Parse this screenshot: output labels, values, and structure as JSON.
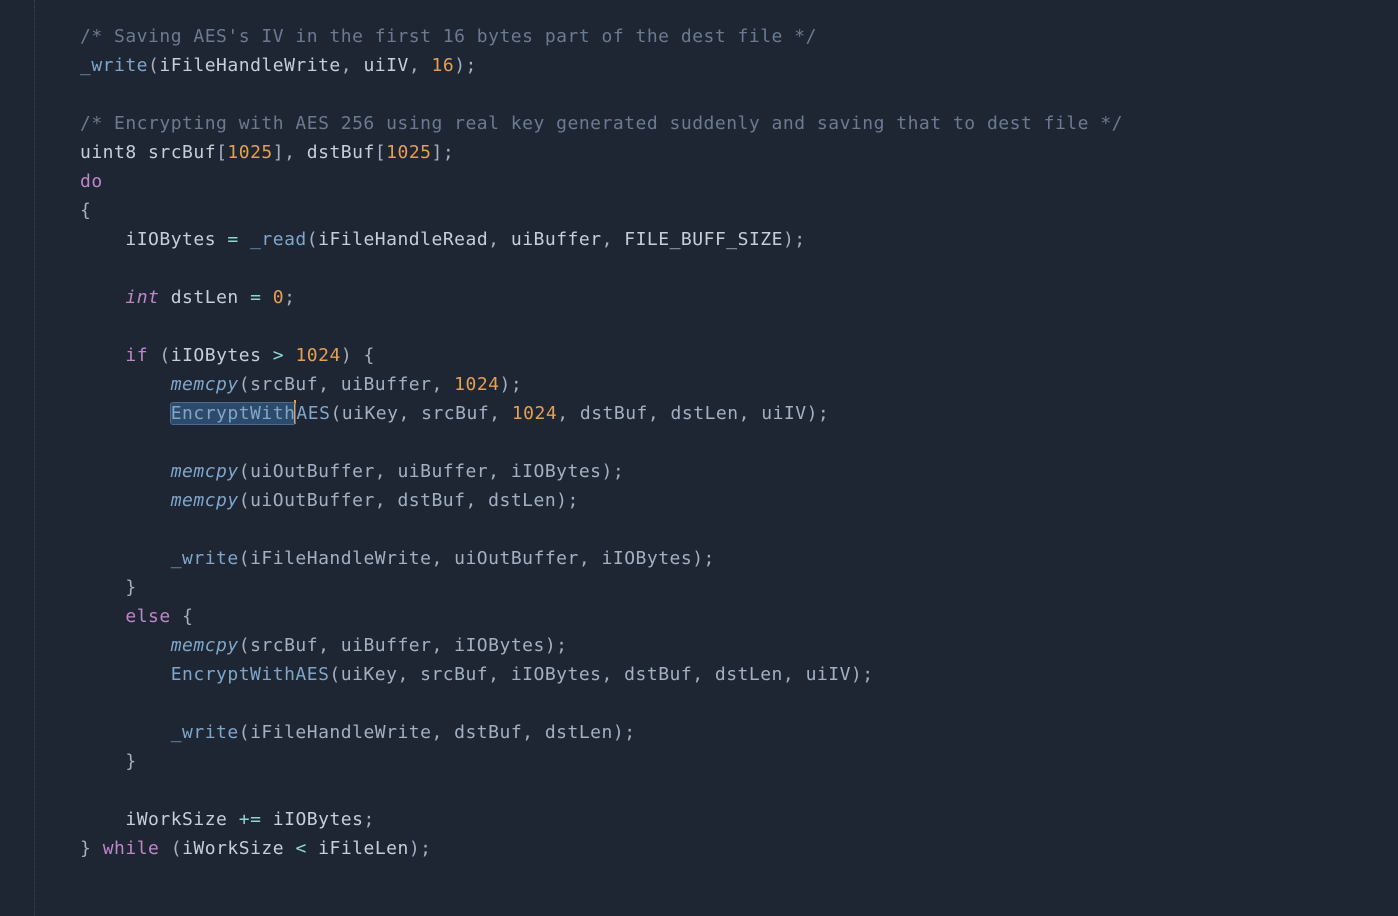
{
  "code": {
    "comment1": "/* Saving AES's IV in the first 16 bytes part of the dest file */",
    "line2_func": "_write",
    "line2_args_open": "(",
    "line2_arg1": "iFileHandleWrite",
    "line2_sep": ", ",
    "line2_arg2": "uiIV",
    "line2_arg3": "16",
    "line2_close": ");",
    "comment2": "/* Encrypting with AES 256 using real key generated suddenly and saving that to dest file */",
    "line4_type": "uint8",
    "line4_v1": "srcBuf",
    "line4_b1o": "[",
    "line4_n1": "1025",
    "line4_b1c": "]",
    "line4_v2": "dstBuf",
    "line4_n2": "1025",
    "line4_end": ";",
    "do_kw": "do",
    "brace_open": "{",
    "l7_ident": "iIOBytes",
    "l7_eq": " = ",
    "l7_func": "_read",
    "l7_args": "(iFileHandleRead, uiBuffer, FILE_BUFF_SIZE);",
    "l7_arg1": "iFileHandleRead",
    "l7_arg2": "uiBuffer",
    "l7_arg3": "FILE_BUFF_SIZE",
    "l8_type": "int",
    "l8_ident": "dstLen",
    "l8_val": "0",
    "if_kw": "if",
    "l9_cond_ident": "iIOBytes",
    "l9_op": ">",
    "l9_num": "1024",
    "memcpy": "memcpy",
    "l10_args": "(srcBuf, uiBuffer, ",
    "l10_num": "1024",
    "l10_close": ");",
    "l11_sel": "EncryptWith",
    "l11_rest_fn": "AES",
    "l11_args_a": "(uiKey, srcBuf, ",
    "l11_num": "1024",
    "l11_args_b": ", dstBuf, dstLen, uiIV);",
    "l12_args": "(uiOutBuffer, uiBuffer, iIOBytes);",
    "l13_args": "(uiOutBuffer, dstBuf, dstLen);",
    "l14_func": "_write",
    "l14_args": "(iFileHandleWrite, uiOutBuffer, iIOBytes);",
    "brace_close": "}",
    "else_kw": "else",
    "l16_args": "(srcBuf, uiBuffer, iIOBytes);",
    "l17_fn": "EncryptWithAES",
    "l17_args": "(uiKey, srcBuf, iIOBytes, dstBuf, dstLen, uiIV);",
    "l18_func": "_write",
    "l18_args": "(iFileHandleWrite, dstBuf, dstLen);",
    "l19_ident": "iWorkSize",
    "l19_op": "+=",
    "l19_rhs": "iIOBytes",
    "l19_end": ";",
    "while_kw": "while",
    "l20_lhs": "iWorkSize",
    "l20_op": "<",
    "l20_rhs": "iFileLen",
    "l20_end": ");"
  }
}
